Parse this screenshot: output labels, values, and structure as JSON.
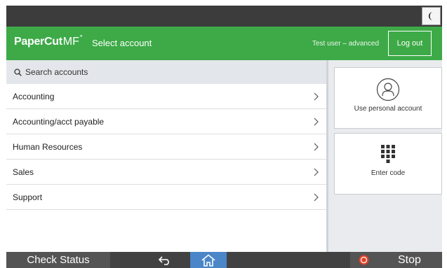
{
  "topbar": {
    "night_mode_icon": "moon-icon"
  },
  "header": {
    "logo_bold": "PaperCut",
    "logo_light": "MF",
    "logo_mark": "°",
    "title": "Select account",
    "user": "Test user – advanced",
    "logout_label": "Log out",
    "brand_color": "#3daa47"
  },
  "search": {
    "placeholder": "Search accounts",
    "icon": "search-icon"
  },
  "accounts": [
    {
      "label": "Accounting"
    },
    {
      "label": "Accounting/acct payable"
    },
    {
      "label": "Human Resources"
    },
    {
      "label": "Sales"
    },
    {
      "label": "Support"
    }
  ],
  "actions": {
    "personal": {
      "label": "Use personal account",
      "icon": "user-icon"
    },
    "code": {
      "label": "Enter code",
      "icon": "keypad-icon"
    }
  },
  "bottombar": {
    "check_status": "Check Status",
    "back_icon": "back-arrow-icon",
    "home_icon": "home-icon",
    "stop_label": "Stop",
    "stop_icon": "stop-icon"
  }
}
